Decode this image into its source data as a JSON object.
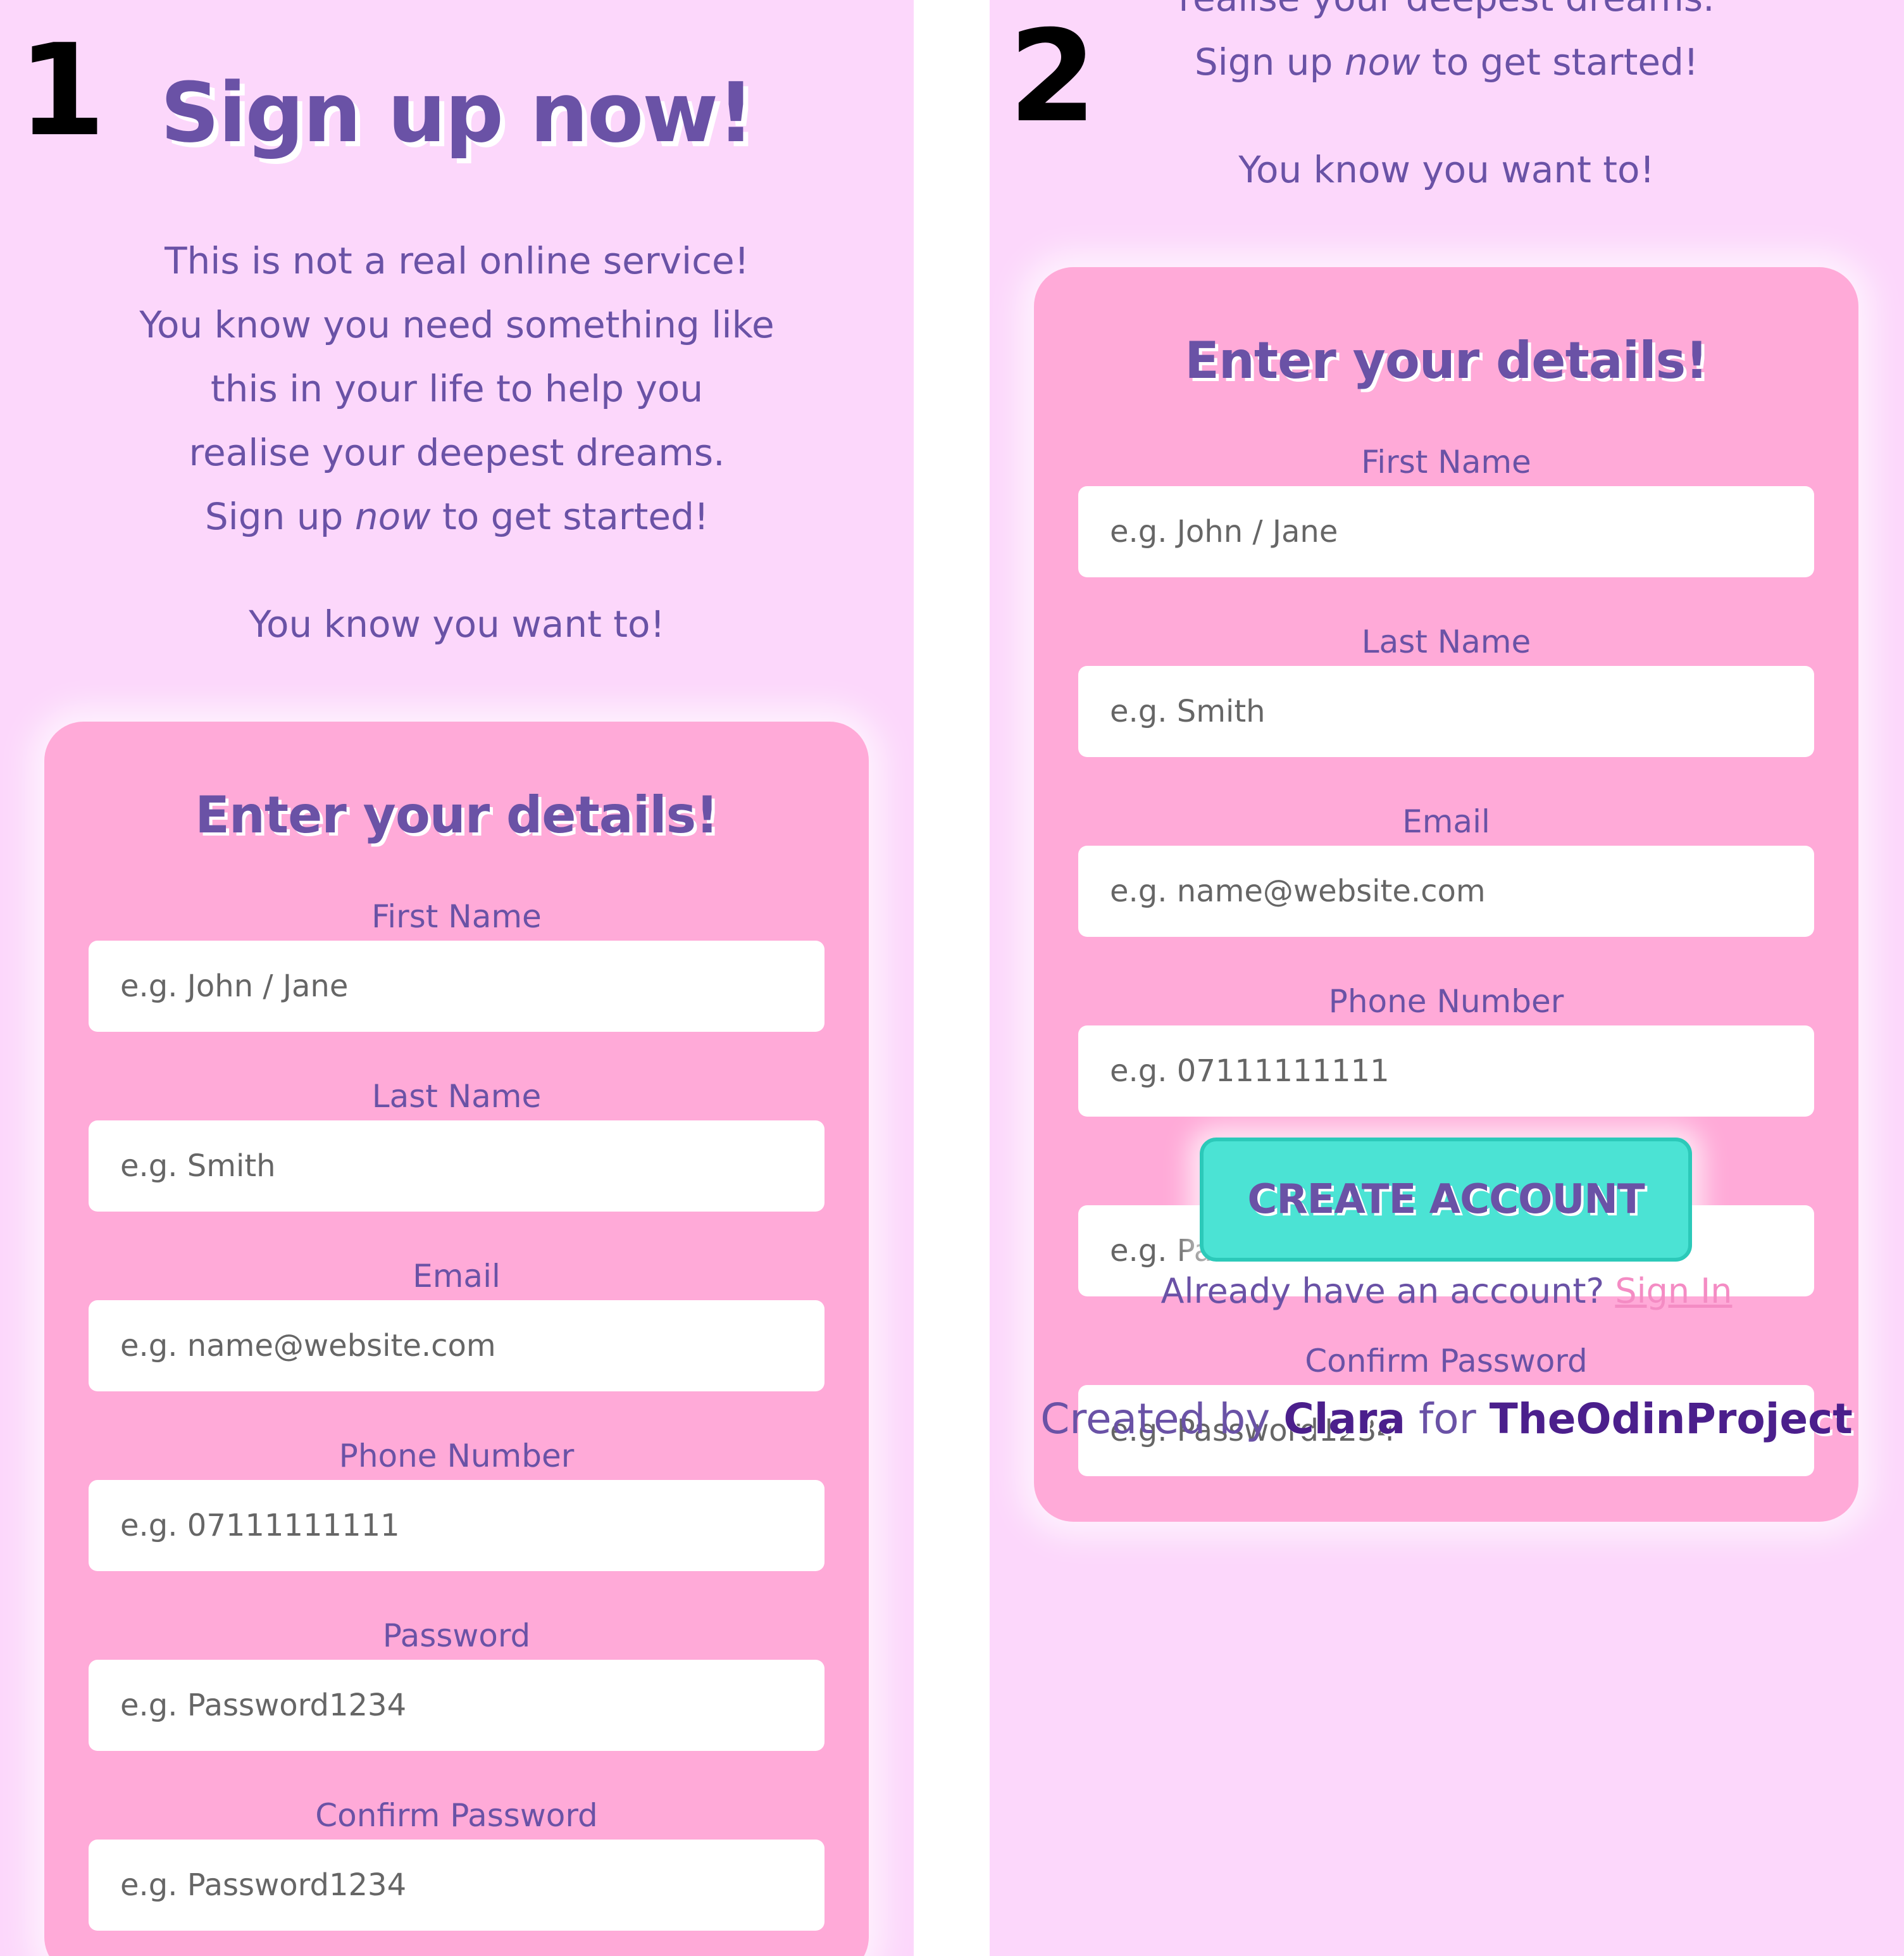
{
  "panel_numbers": [
    "1",
    "2"
  ],
  "heading": "Sign up now!",
  "intro": {
    "line1": "This is not a real online service!",
    "line2": "You know you need something like",
    "line3": "this in your life to help you",
    "line4": "realise your deepest dreams.",
    "line5_before": "Sign up ",
    "line5_em": "now",
    "line5_after": " to get started!",
    "closing": "You know you want to!"
  },
  "form": {
    "title": "Enter your details!",
    "fields": [
      {
        "label": "First Name",
        "placeholder": "e.g. John / Jane"
      },
      {
        "label": "Last Name",
        "placeholder": "e.g. Smith"
      },
      {
        "label": "Email",
        "placeholder": "e.g. name@website.com"
      },
      {
        "label": "Phone Number",
        "placeholder": "e.g. 07111111111"
      },
      {
        "label": "Password",
        "placeholder": "e.g. Password1234"
      },
      {
        "label": "Confirm Password",
        "placeholder": "e.g. Password1234"
      }
    ]
  },
  "create_button": "CREATE ACCOUNT",
  "signin": {
    "text": "Already have an account? ",
    "link": "Sign In"
  },
  "footer": {
    "prefix": "Created by ",
    "author": "Clara",
    "middle": " for ",
    "project": "TheOdinProject"
  },
  "colors": {
    "page_background": "#fcd7fb",
    "card_background": "#ffaad8",
    "text_purple": "#6a52a6",
    "footer_bold": "#4b1f8c",
    "button_teal": "#4be3d4",
    "link_pink": "#f48cc4"
  }
}
